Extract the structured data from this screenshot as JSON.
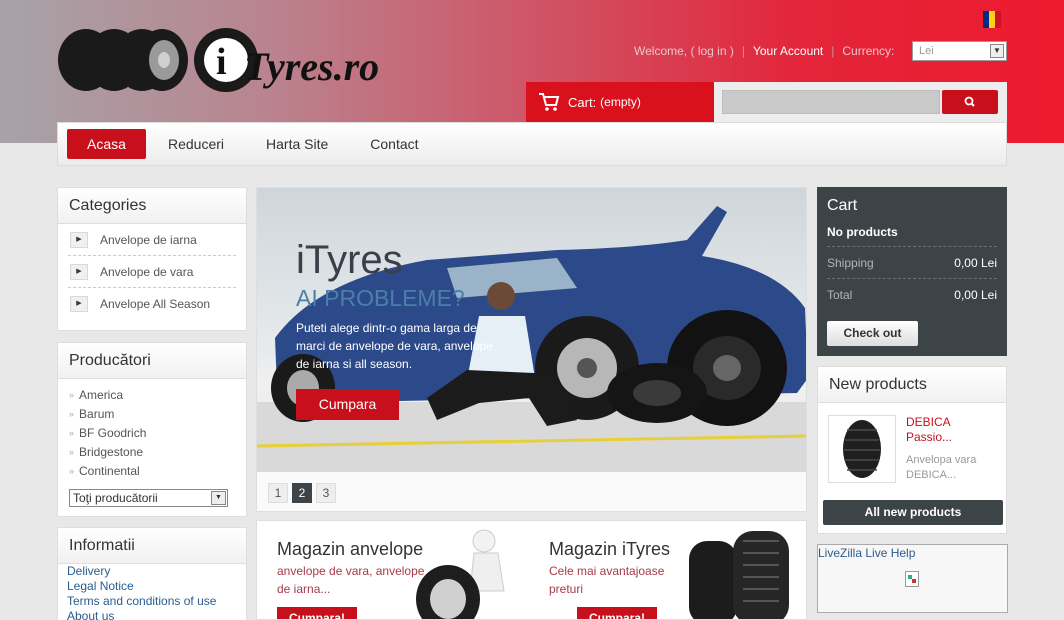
{
  "header": {
    "logo_text": "iTyres.ro",
    "welcome_text": "Welcome,",
    "login_link": "( log in )",
    "account_link": "Your Account",
    "currency_label": "Currency:",
    "currency_value": "Lei"
  },
  "cart_bar": {
    "label": "Cart:",
    "status": "(empty)"
  },
  "nav": {
    "items": [
      "Acasa",
      "Reduceri",
      "Harta Site",
      "Contact"
    ]
  },
  "categories": {
    "title": "Categories",
    "items": [
      "Anvelope de iarna",
      "Anvelope de vara",
      "Anvelope All Season"
    ]
  },
  "manufacturers": {
    "title": "Producători",
    "items": [
      "America",
      "Barum",
      "BF Goodrich",
      "Bridgestone",
      "Continental"
    ],
    "select_value": "Toţi producătorii"
  },
  "info": {
    "title": "Informatii",
    "items": [
      "Delivery",
      "Legal Notice",
      "Terms and conditions of use",
      "About us"
    ]
  },
  "slider": {
    "title": "iTyres",
    "subtitle": "AI PROBLEME?",
    "description": "Puteti alege dintr-o gama larga de marci de anvelope de vara, anvelope de iarna si all season.",
    "button": "Cumpara",
    "pages": [
      "1",
      "2",
      "3"
    ],
    "active_page": "2"
  },
  "promo": {
    "left_title": "Magazin anvelope",
    "left_desc": "anvelope de vara, anvelope de iarna...",
    "left_button": "Cumpara!",
    "right_title": "Magazin iTyres",
    "right_desc": "Cele mai avantajoase preturi",
    "right_button": "Cumpara!"
  },
  "cart_box": {
    "title": "Cart",
    "no_products": "No products",
    "shipping_label": "Shipping",
    "shipping_value": "0,00 Lei",
    "total_label": "Total",
    "total_value": "0,00 Lei",
    "checkout": "Check out"
  },
  "new_products": {
    "title": "New products",
    "product_name": "DEBICA Passio...",
    "product_desc": "Anvelopa vara DEBICA...",
    "all_button": "All new products"
  },
  "livezilla": {
    "title": "LiveZilla Live Help"
  },
  "colors": {
    "brand_red": "#c8101c",
    "dark_panel": "#3d4448",
    "flag": [
      "#002b7f",
      "#fcd116",
      "#ce1126"
    ]
  }
}
